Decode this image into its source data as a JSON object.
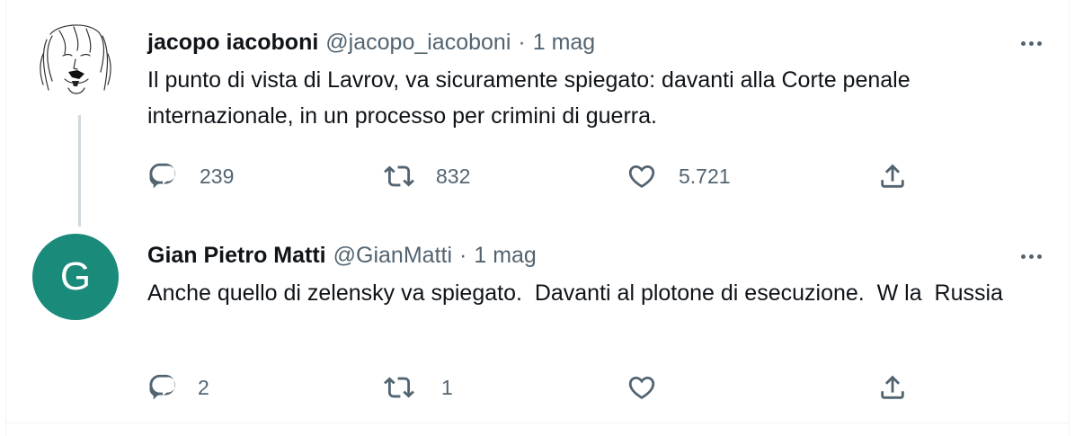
{
  "tweets": [
    {
      "name": "jacopo iacoboni",
      "handle": "@jacopo_iacoboni",
      "separator": "·",
      "time": "1 mag",
      "text": "Il punto di vista di Lavrov, va sicuramente spiegato: davanti alla Corte penale internazionale, in un processo per crimini di guerra.",
      "avatar_type": "illustrated-portrait",
      "replies": "239",
      "retweets": "832",
      "likes": "5.721"
    },
    {
      "name": "Gian Pietro Matti",
      "handle": "@GianMatti",
      "separator": "·",
      "time": "1 mag",
      "text": "Anche quello di zelensky va spiegato.  Davanti al plotone di esecuzione.  W la  Russia",
      "avatar_letter": "G",
      "avatar_color": "#1a8a7a",
      "replies": "2",
      "retweets": "1",
      "likes": ""
    }
  ],
  "icons": {
    "reply": "reply-icon",
    "retweet": "retweet-icon",
    "like": "heart-icon",
    "share": "share-icon",
    "more": "more-icon"
  },
  "colors": {
    "text": "#0f1419",
    "secondary": "#536471",
    "thread_line": "#cfd9de",
    "divider": "#eff3f4"
  }
}
